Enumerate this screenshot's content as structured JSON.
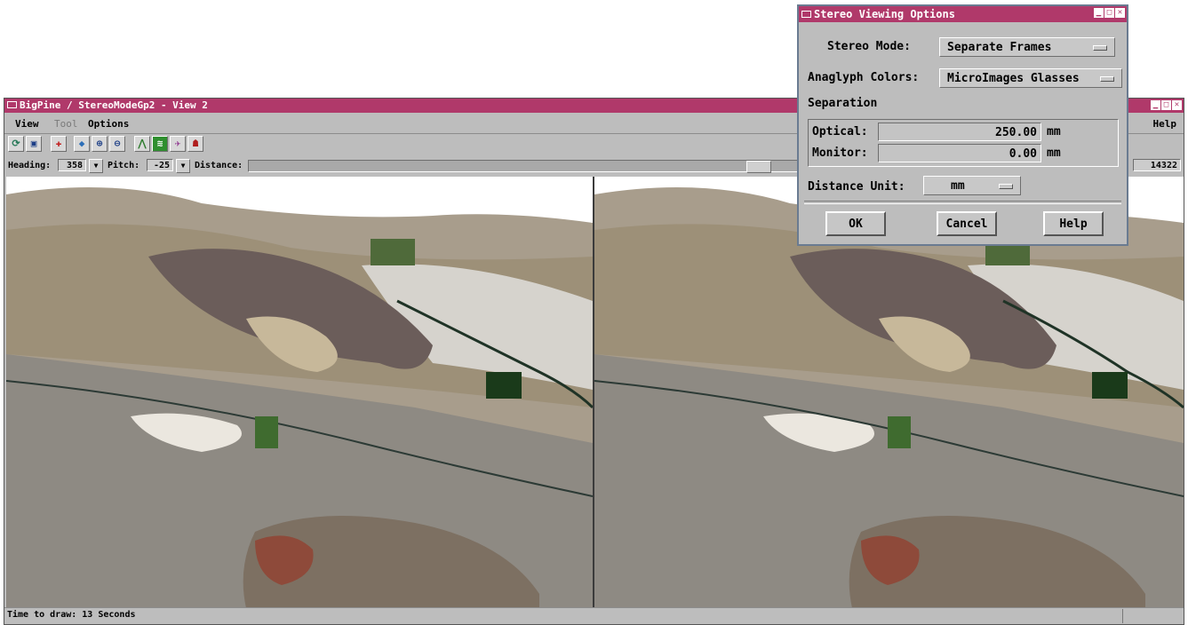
{
  "main_window": {
    "title": "BigPine / StereoModeGp2 - View 2",
    "menu": {
      "view": "View",
      "tool": "Tool",
      "options": "Options",
      "help": "Help"
    },
    "toolbar_icons": [
      "redraw-icon",
      "full-view-icon",
      "pan-icon",
      "zoom-box-icon",
      "zoom-in-icon",
      "zoom-out-icon",
      "terrain-icon",
      "stereo-icon",
      "flyby-icon",
      "camera-icon"
    ],
    "nav": {
      "heading_label": "Heading:",
      "heading_value": "358",
      "pitch_label": "Pitch:",
      "pitch_value": "-25",
      "distance_label": "Distance:",
      "distance_value": "14322"
    },
    "status": "Time to draw: 13 Seconds",
    "title_bar_color": "#b0396a"
  },
  "dialog": {
    "title": "Stereo Viewing Options",
    "stereo_mode_label": "Stereo Mode:",
    "stereo_mode_value": "Separate Frames",
    "anaglyph_label": "Anaglyph Colors:",
    "anaglyph_value": "MicroImages Glasses",
    "separation_label": "Separation",
    "optical_label": "Optical:",
    "optical_value": "250.00",
    "optical_unit": "mm",
    "monitor_label": "Monitor:",
    "monitor_value": "0.00",
    "monitor_unit": "mm",
    "distance_unit_label": "Distance Unit:",
    "distance_unit_value": "mm",
    "ok": "OK",
    "cancel": "Cancel",
    "help": "Help"
  }
}
